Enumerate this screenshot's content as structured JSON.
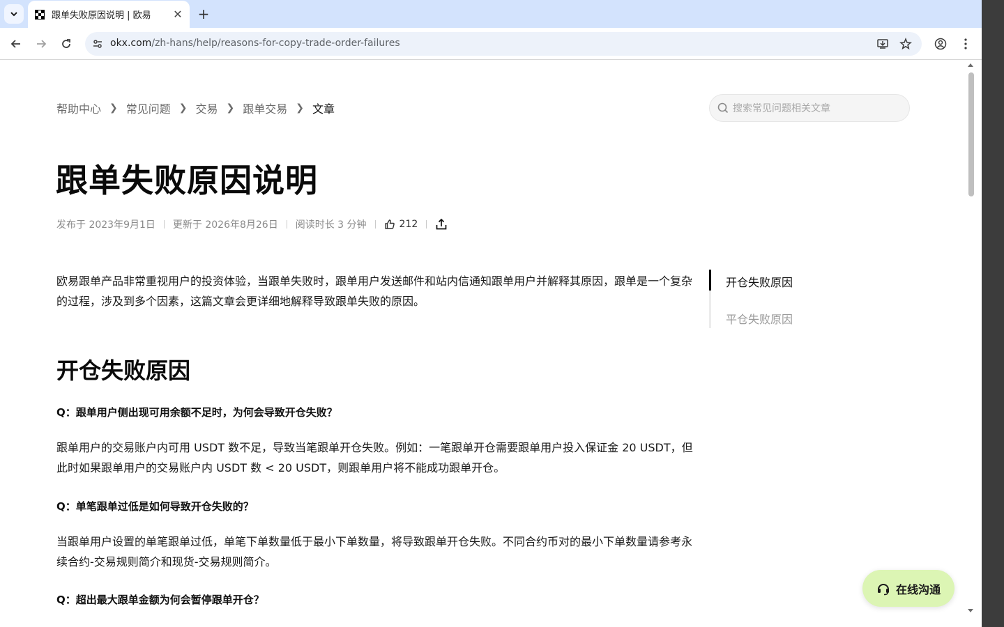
{
  "browser": {
    "tab_title": "跟单失败原因说明 | 欧易",
    "url_domain": "okx.com",
    "url_path": "/zh-hans/help/reasons-for-copy-trade-order-failures"
  },
  "breadcrumb": {
    "items": [
      "帮助中心",
      "常见问题",
      "交易",
      "跟单交易"
    ],
    "current": "文章"
  },
  "search": {
    "placeholder": "搜索常见问题相关文章"
  },
  "article": {
    "title": "跟单失败原因说明",
    "published": "发布于 2023年9月1日",
    "updated": "更新于 2026年8月26日",
    "read_time": "阅读时长 3 分钟",
    "likes": "212",
    "intro": "欧易跟单产品非常重视用户的投资体验，当跟单失败时，跟单用户发送邮件和站内信通知跟单用户并解释其原因，跟单是一个复杂的过程，涉及到多个因素，这篇文章会更详细地解释导致跟单失败的原因。",
    "section_title": "开仓失败原因",
    "qas": [
      {
        "q": "Q：跟单用户侧出现可用余额不足时，为何会导致开仓失败？",
        "a": "跟单用户的交易账户内可用 USDT 数不足，导致当笔跟单开仓失败。例如：一笔跟单开仓需要跟单用户投入保证金 20 USDT，但此时如果跟单用户的交易账户内 USDT 数 < 20 USDT，则跟单用户将不能成功跟单开仓。"
      },
      {
        "q": "Q：单笔跟单过低是如何导致开仓失败的？",
        "a": "当跟单用户设置的单笔跟单过低，单笔下单数量低于最小下单数量，将导致跟单开仓失败。不同合约币对的最小下单数量请参考永续合约-交易规则简介和现货-交易规则简介。"
      },
      {
        "q": "Q：超出最大跟单金额为何会暂停跟单开仓？",
        "a": ""
      }
    ]
  },
  "toc": {
    "items": [
      "开仓失败原因",
      "平仓失败原因"
    ]
  },
  "chat": {
    "label": "在线沟通"
  },
  "colors": {
    "tabbar": "#d3e3fd",
    "omnibox": "#edf2fa",
    "chat_bg": "#dcf5b4"
  }
}
